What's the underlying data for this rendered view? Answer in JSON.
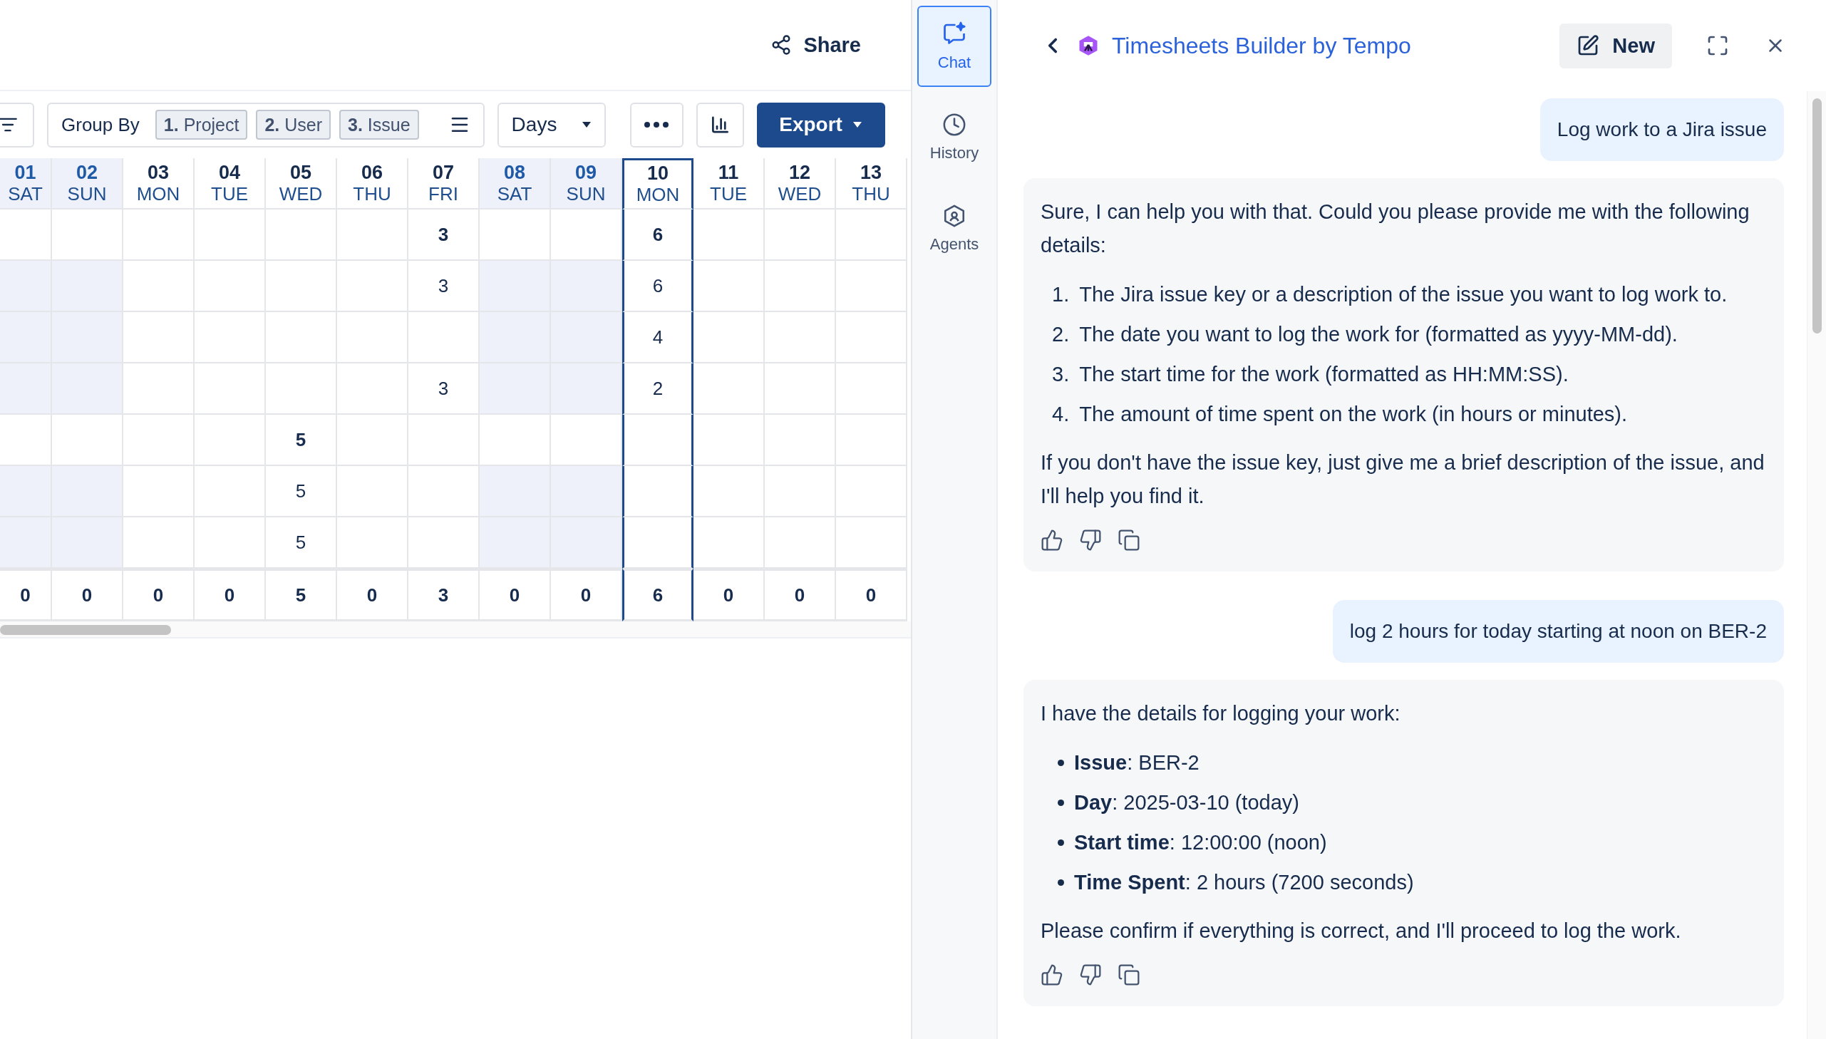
{
  "header": {
    "share_label": "Share"
  },
  "toolbar": {
    "group_by_label": "Group By",
    "group_chips": [
      "**1.** Project",
      "**2.** User",
      "**3.** Issue"
    ],
    "period": "Days",
    "export_label": "Export"
  },
  "grid": {
    "columns": [
      {
        "day": "01",
        "weekday": "SAT",
        "weekend": true,
        "today": false
      },
      {
        "day": "02",
        "weekday": "SUN",
        "weekend": true,
        "today": false
      },
      {
        "day": "03",
        "weekday": "MON",
        "weekend": false,
        "today": false
      },
      {
        "day": "04",
        "weekday": "TUE",
        "weekend": false,
        "today": false
      },
      {
        "day": "05",
        "weekday": "WED",
        "weekend": false,
        "today": false
      },
      {
        "day": "06",
        "weekday": "THU",
        "weekend": false,
        "today": false
      },
      {
        "day": "07",
        "weekday": "FRI",
        "weekend": false,
        "today": false
      },
      {
        "day": "08",
        "weekday": "SAT",
        "weekend": true,
        "today": false
      },
      {
        "day": "09",
        "weekday": "SUN",
        "weekend": true,
        "today": false
      },
      {
        "day": "10",
        "weekday": "MON",
        "weekend": false,
        "today": true
      },
      {
        "day": "11",
        "weekday": "TUE",
        "weekend": false,
        "today": false
      },
      {
        "day": "12",
        "weekday": "WED",
        "weekend": false,
        "today": false
      },
      {
        "day": "13",
        "weekday": "THU",
        "weekend": false,
        "today": false
      }
    ],
    "rows": [
      {
        "kind": "group",
        "cells": [
          null,
          null,
          null,
          null,
          null,
          null,
          "3",
          null,
          null,
          "6",
          null,
          null,
          null
        ]
      },
      {
        "kind": "entry",
        "cells": [
          null,
          null,
          null,
          null,
          null,
          null,
          "3",
          null,
          null,
          "6",
          null,
          null,
          null
        ]
      },
      {
        "kind": "entry",
        "cells": [
          null,
          null,
          null,
          null,
          null,
          null,
          null,
          null,
          null,
          "4",
          null,
          null,
          null
        ]
      },
      {
        "kind": "entry",
        "cells": [
          null,
          null,
          null,
          null,
          null,
          null,
          "3",
          null,
          null,
          "2",
          null,
          null,
          null
        ]
      },
      {
        "kind": "group",
        "cells": [
          null,
          null,
          null,
          null,
          "5",
          null,
          null,
          null,
          null,
          null,
          null,
          null,
          null
        ]
      },
      {
        "kind": "entry",
        "cells": [
          null,
          null,
          null,
          null,
          "5",
          null,
          null,
          null,
          null,
          null,
          null,
          null,
          null
        ]
      },
      {
        "kind": "entry",
        "cells": [
          null,
          null,
          null,
          null,
          "5",
          null,
          null,
          null,
          null,
          null,
          null,
          null,
          null
        ]
      }
    ],
    "totals": [
      "0",
      "0",
      "0",
      "0",
      "5",
      "0",
      "3",
      "0",
      "0",
      "6",
      "0",
      "0",
      "0"
    ]
  },
  "sidebar": {
    "items": [
      {
        "kind": "chat",
        "label": "Chat",
        "selected": true
      },
      {
        "kind": "history",
        "label": "History",
        "selected": false
      },
      {
        "kind": "agents",
        "label": "Agents",
        "selected": false
      }
    ]
  },
  "chat": {
    "title": "Timesheets Builder by Tempo",
    "new_label": "New",
    "messages": [
      {
        "kind": "user",
        "text": "Log work to a Jira issue"
      },
      {
        "kind": "assistant",
        "blocks": [
          {
            "kind": "paragraph",
            "text": "Sure, I can help you with that. Could you please provide me with the following details:"
          },
          {
            "kind": "ordered_list",
            "items": [
              {
                "number": "1.",
                "text": "The Jira issue key or a description of the issue you want to log work to."
              },
              {
                "number": "2.",
                "text": "The date you want to log the work for (formatted as yyyy-MM-dd)."
              },
              {
                "number": "3.",
                "text": "The start time for the work (formatted as HH:MM:SS)."
              },
              {
                "number": "4.",
                "text": "The amount of time spent on the work (in hours or minutes)."
              }
            ]
          },
          {
            "kind": "paragraph",
            "text": "If you don't have the issue key, just give me a brief description of the issue, and I'll help you find it."
          }
        ]
      },
      {
        "kind": "user",
        "text": "log 2 hours for today starting at noon on BER-2"
      },
      {
        "kind": "assistant",
        "blocks": [
          {
            "kind": "paragraph",
            "text": "I have the details for logging your work:"
          },
          {
            "kind": "bullet_list",
            "items": [
              {
                "text": "**Issue**: BER-2"
              },
              {
                "text": "**Day**: 2025-03-10 (today)"
              },
              {
                "text": "**Start time**: 12:00:00 (noon)"
              },
              {
                "text": "**Time Spent**: 2 hours (7200 seconds)"
              }
            ]
          },
          {
            "kind": "paragraph",
            "text": "Please confirm if everything is correct, and I'll proceed to log the work."
          }
        ]
      }
    ]
  }
}
